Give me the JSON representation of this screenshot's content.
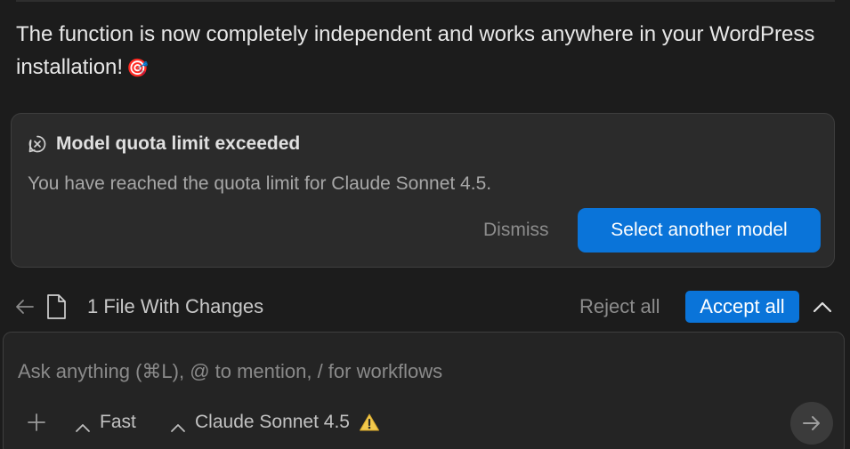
{
  "message": {
    "text": "The function is now completely independent and works anywhere in your WordPress installation!",
    "emoji": "🎯"
  },
  "quota_card": {
    "title": "Model quota limit exceeded",
    "description": "You have reached the quota limit for Claude Sonnet 4.5.",
    "dismiss_label": "Dismiss",
    "select_model_label": "Select another model",
    "icon": "alert-circle-icon"
  },
  "changes_bar": {
    "label": "1 File With Changes",
    "reject_label": "Reject all",
    "accept_label": "Accept all",
    "icons": [
      "back-arrow-icon",
      "file-icon",
      "chevron-up-icon"
    ]
  },
  "input": {
    "placeholder": "Ask anything (⌘L), @ to mention, / for workflows",
    "value": "",
    "mode_label": "Fast",
    "model_label": "Claude Sonnet 4.5",
    "icons": [
      "plus-icon",
      "caret-up-icon",
      "warning-icon",
      "send-arrow-icon"
    ]
  },
  "colors": {
    "background": "#1c1c1c",
    "card": "#2b2b2b",
    "accent": "#0a74d9",
    "warning": "#f2c94c"
  }
}
